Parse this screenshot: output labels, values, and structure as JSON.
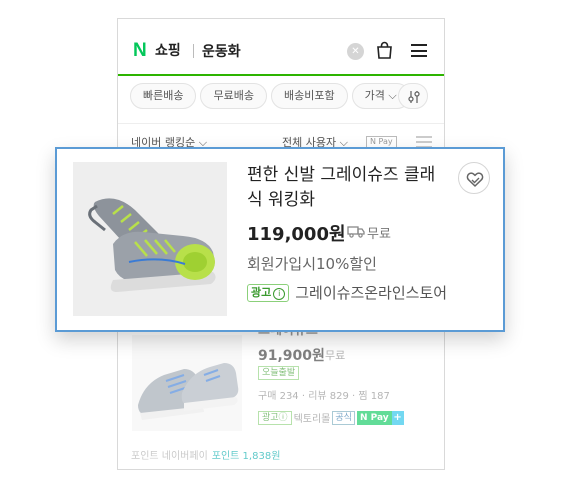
{
  "header": {
    "logo_mark": "N",
    "service_name": "쇼핑",
    "search_query": "운동화",
    "clear_glyph": "✕"
  },
  "filters": {
    "chips": [
      "빠른배송",
      "무료배송",
      "배송비포함",
      "가격 ⌵"
    ]
  },
  "sortbar": {
    "left_label": "네이버 랭킹순 ⌵",
    "right_label": "전체 사용자 ⌵",
    "npay_label": "N Pay"
  },
  "featured_product": {
    "title": "편한 신발 그레이슈즈 클래식 워킹화",
    "price": "119,000원",
    "shipping": "무료",
    "promo": "회원가입시10%할인",
    "ad_label": "광고",
    "ad_info": "i",
    "store": "그레이슈즈온라인스토어"
  },
  "second_product": {
    "title": "그레이슈즈",
    "price": "91,900원",
    "shipping": "무료",
    "badge": "오늘출발",
    "meta": "구매 234 · 리뷰 829 · 찜 187",
    "ad_label": "광고ⓘ",
    "store": "텍토리몰",
    "tag": "공식",
    "npay": "N Pay",
    "plus": "+"
  },
  "points": {
    "label": "포인트  네이버페이",
    "value": "포인트 1,838원"
  },
  "colors": {
    "naver_green": "#03c75a",
    "header_line": "#2db400",
    "card_border": "#5b9bd5",
    "ad_green": "#3a9a2e"
  }
}
